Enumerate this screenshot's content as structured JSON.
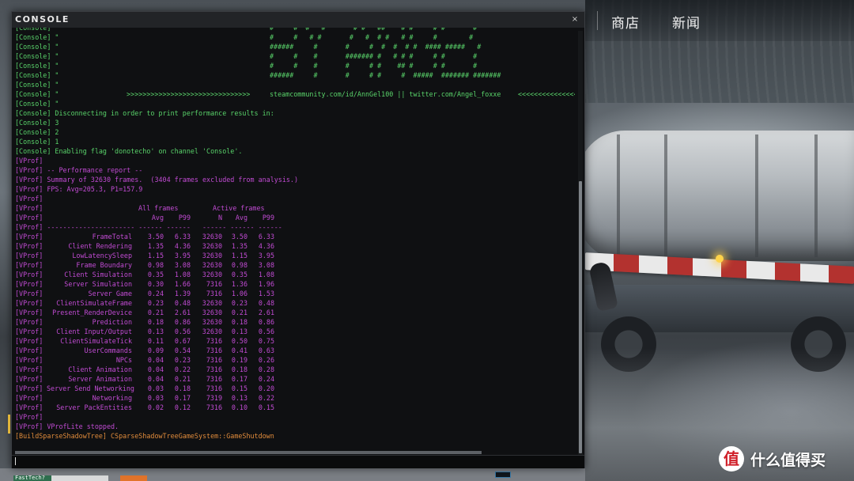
{
  "window": {
    "title": "CONSOLE",
    "close_label": "×"
  },
  "nav": {
    "store": "商店",
    "news": "新闻"
  },
  "watermark": {
    "logo": "值",
    "text": "什么值得买"
  },
  "hud": {
    "tag": "FastTech?"
  },
  "input": {
    "value": "",
    "placeholder": ""
  },
  "ascii_lines": [
    {
      "prefix": "[Console] \"",
      "art": "#     #  #   #       # #   ##    # #     # #       #"
    },
    {
      "prefix": "[Console] \"",
      "art": "#     #   # #       #   #  # #   # #     #        #"
    },
    {
      "prefix": "[Console] \"",
      "art": "######     #       #     #  #  #  # #  #### #####   #"
    },
    {
      "prefix": "[Console] \"",
      "art": "#     #    #       ####### #   # # #     # #       #"
    },
    {
      "prefix": "[Console] \"",
      "art": "#     #    #       #     # #    ## #     # #       #"
    },
    {
      "prefix": "[Console] \"",
      "art": "######     #       #     # #     #  #####  ####### #######"
    },
    {
      "prefix": "[Console] \"",
      "art": ""
    }
  ],
  "credit_line": {
    "prefix": "[Console] \"",
    "arrows_left": ">>>>>>>>>>>>>>>>>>>>>>>>>>>>>>>",
    "urls": "steamcommunity.com/id/AnnGel100 || twitter.com/Angel_foxxe",
    "arrows_right": "<<<<<<<<<<<<<<<<<"
  },
  "console_lines": [
    "[Console] \"",
    "[Console] Disconnecting in order to print performance results in:",
    "[Console] 3",
    "[Console] 2",
    "[Console] 1",
    "[Console] Enabling flag 'donotecho' on channel 'Console'."
  ],
  "vprof_intro": [
    "[VProf]",
    "[VProf] -- Performance report --",
    "[VProf] Summary of 32630 frames.  (3404 frames excluded from analysis.)",
    "[VProf] FPS: Avg=205.3, P1=157.9",
    "[VProf]"
  ],
  "table": {
    "prefix": "[VProf]",
    "group_all": "All frames",
    "group_active": "Active frames",
    "col_avg": "Avg",
    "col_p99": "P99",
    "col_n": "N",
    "col_avg2": "Avg",
    "col_p992": "P99",
    "separator": "[VProf] ---------------------- ------ ------   ------ ------ ------",
    "rows": [
      {
        "name": "FrameTotal",
        "avg": "3.50",
        "p99": "6.33",
        "n": "32630",
        "aavg": "3.50",
        "ap99": "6.33"
      },
      {
        "name": "Client Rendering",
        "avg": "1.35",
        "p99": "4.36",
        "n": "32630",
        "aavg": "1.35",
        "ap99": "4.36"
      },
      {
        "name": "LowLatencySleep",
        "avg": "1.15",
        "p99": "3.95",
        "n": "32630",
        "aavg": "1.15",
        "ap99": "3.95"
      },
      {
        "name": "Frame Boundary",
        "avg": "0.98",
        "p99": "3.08",
        "n": "32630",
        "aavg": "0.98",
        "ap99": "3.08"
      },
      {
        "name": "Client Simulation",
        "avg": "0.35",
        "p99": "1.08",
        "n": "32630",
        "aavg": "0.35",
        "ap99": "1.08"
      },
      {
        "name": "Server Simulation",
        "avg": "0.30",
        "p99": "1.66",
        "n": "7316",
        "aavg": "1.36",
        "ap99": "1.96"
      },
      {
        "name": "Server Game",
        "avg": "0.24",
        "p99": "1.39",
        "n": "7316",
        "aavg": "1.06",
        "ap99": "1.53"
      },
      {
        "name": "ClientSimulateFrame",
        "avg": "0.23",
        "p99": "0.48",
        "n": "32630",
        "aavg": "0.23",
        "ap99": "0.48"
      },
      {
        "name": "Present_RenderDevice",
        "avg": "0.21",
        "p99": "2.61",
        "n": "32630",
        "aavg": "0.21",
        "ap99": "2.61"
      },
      {
        "name": "Prediction",
        "avg": "0.18",
        "p99": "0.86",
        "n": "32630",
        "aavg": "0.18",
        "ap99": "0.86"
      },
      {
        "name": "Client Input/Output",
        "avg": "0.13",
        "p99": "0.56",
        "n": "32630",
        "aavg": "0.13",
        "ap99": "0.56"
      },
      {
        "name": "ClientSimulateTick",
        "avg": "0.11",
        "p99": "0.67",
        "n": "7316",
        "aavg": "0.50",
        "ap99": "0.75"
      },
      {
        "name": "UserCommands",
        "avg": "0.09",
        "p99": "0.54",
        "n": "7316",
        "aavg": "0.41",
        "ap99": "0.63"
      },
      {
        "name": "NPCs",
        "avg": "0.04",
        "p99": "0.23",
        "n": "7316",
        "aavg": "0.19",
        "ap99": "0.26"
      },
      {
        "name": "Client Animation",
        "avg": "0.04",
        "p99": "0.22",
        "n": "7316",
        "aavg": "0.18",
        "ap99": "0.28"
      },
      {
        "name": "Server Animation",
        "avg": "0.04",
        "p99": "0.21",
        "n": "7316",
        "aavg": "0.17",
        "ap99": "0.24"
      },
      {
        "name": "Server Send Networking",
        "avg": "0.03",
        "p99": "0.18",
        "n": "7316",
        "aavg": "0.15",
        "ap99": "0.20"
      },
      {
        "name": "Networking",
        "avg": "0.03",
        "p99": "0.17",
        "n": "7319",
        "aavg": "0.13",
        "ap99": "0.22"
      },
      {
        "name": "Server PackEntities",
        "avg": "0.02",
        "p99": "0.12",
        "n": "7316",
        "aavg": "0.10",
        "ap99": "0.15"
      }
    ]
  },
  "vprof_outro": [
    "[VProf]",
    "[VProf] VProfLite stopped."
  ],
  "shutdown_line": "[BuildSparseShadowTree] CSparseShadowTreeGameSystem::GameShutdown",
  "colors": {
    "console_green": "#59d36a",
    "vprof_magenta": "#c14bd3",
    "warning_orange": "#e08b3b",
    "barrier_red": "#b3322f"
  }
}
